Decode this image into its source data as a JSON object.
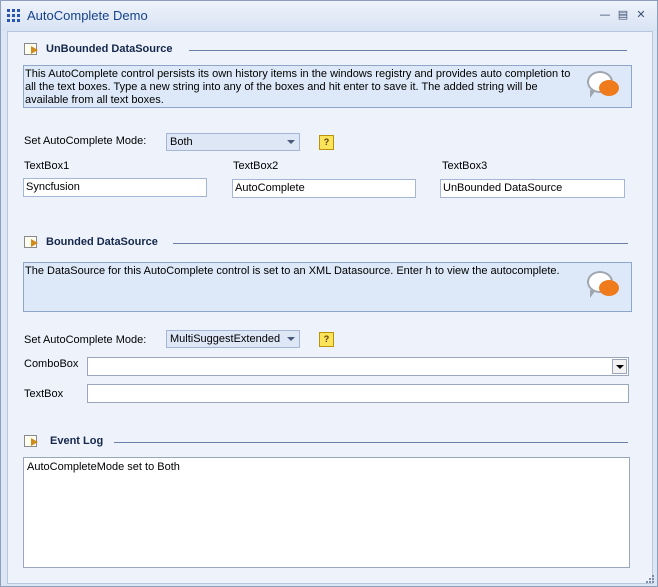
{
  "window": {
    "title": "AutoComplete Demo",
    "controls": [
      "minimize-icon",
      "maximize-icon",
      "close-icon"
    ]
  },
  "unbounded": {
    "title": "UnBounded DataSource",
    "description": "This AutoComplete control persists its own history items in the windows registry and provides auto completion to all the text boxes. Type a new string into any of the boxes and hit enter to save it. The added string will be available from all text boxes.",
    "mode_label": "Set AutoComplete Mode:",
    "mode_value": "Both",
    "textbox1_label": "TextBox1",
    "textbox1_value": "Syncfusion",
    "textbox2_label": "TextBox2",
    "textbox2_value": "AutoComplete",
    "textbox3_label": "TextBox3",
    "textbox3_value": "UnBounded DataSource"
  },
  "bounded": {
    "title": "Bounded DataSource",
    "description": "The DataSource for this AutoComplete control is set to an XML Datasource. Enter h to view the autocomplete.",
    "mode_label": "Set AutoComplete Mode:",
    "mode_value": "MultiSuggestExtended",
    "combobox_label": "ComboBox",
    "combobox_value": "",
    "textbox_label": "TextBox",
    "textbox_value": ""
  },
  "event_log": {
    "title": "Event Log",
    "entries": [
      "AutoCompleteMode set to Both"
    ]
  },
  "help_glyph": "?",
  "colors": {
    "title_text": "#15428b",
    "panel_bg": "#eef2fb",
    "desc_bg": "#dde9f8",
    "accent_orange": "#f07b1d"
  }
}
